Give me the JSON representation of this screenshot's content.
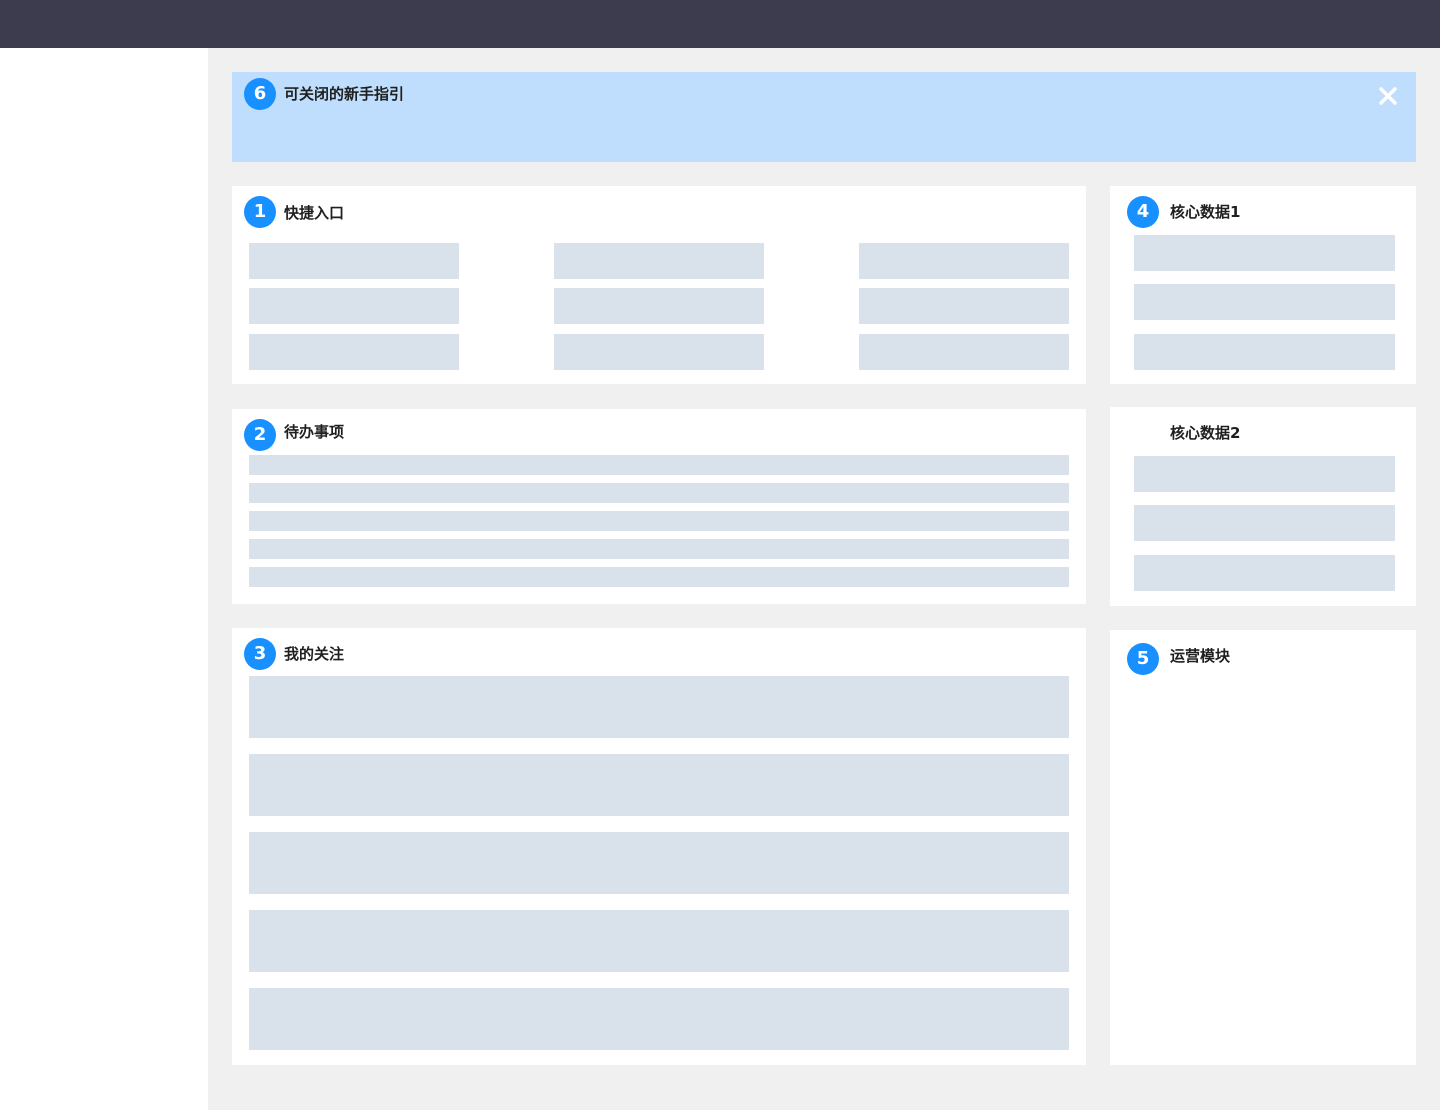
{
  "guide": {
    "badge": "6",
    "title": "可关闭的新手指引",
    "close_icon": "close-icon"
  },
  "quick_entry": {
    "badge": "1",
    "title": "快捷入口"
  },
  "todo": {
    "badge": "2",
    "title": "待办事项"
  },
  "following": {
    "badge": "3",
    "title": "我的关注"
  },
  "core_data_1": {
    "badge": "4",
    "title": "核心数据1"
  },
  "core_data_2": {
    "title": "核心数据2"
  },
  "operations": {
    "badge": "5",
    "title": "运营模块"
  },
  "colors": {
    "topbar": "#3d3c4f",
    "background": "#f0f0f0",
    "guide_banner": "#bfdefd",
    "badge": "#1890ff",
    "placeholder": "#d9e1ea"
  }
}
